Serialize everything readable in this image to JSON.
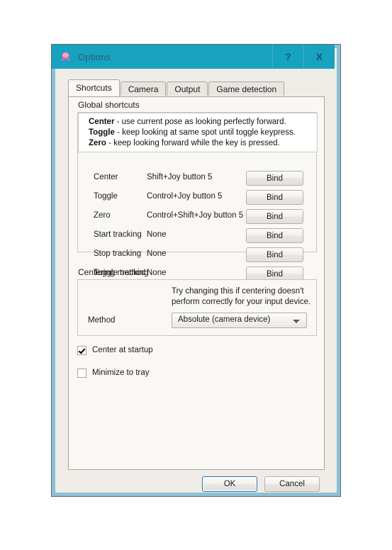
{
  "window": {
    "title": "Options",
    "icon": "opentrack-octopus-icon",
    "help_button": "?",
    "close_button": "X",
    "titlebar_color": "#17a2c0",
    "frame_color": "#8cc0d4",
    "dialog_background": "#efece8"
  },
  "tabs": [
    {
      "label": "Shortcuts",
      "active": true
    },
    {
      "label": "Camera",
      "active": false
    },
    {
      "label": "Output",
      "active": false
    },
    {
      "label": "Game detection",
      "active": false
    }
  ],
  "shortcuts_group": {
    "title": "Global shortcuts",
    "description": [
      {
        "term": "Center",
        "text": " - use current pose as looking perfectly forward."
      },
      {
        "term": "Toggle",
        "text": " - keep looking at same spot until toggle keypress."
      },
      {
        "term": "Zero",
        "text": " - keep looking forward while the key is pressed."
      }
    ],
    "rows": [
      {
        "label": "Center",
        "value": "Shift+Joy button 5",
        "button": "Bind"
      },
      {
        "label": "Toggle",
        "value": "Control+Joy button 5",
        "button": "Bind"
      },
      {
        "label": "Zero",
        "value": "Control+Shift+Joy button 5",
        "button": "Bind"
      },
      {
        "label": "Start tracking",
        "value": "None",
        "button": "Bind"
      },
      {
        "label": "Stop tracking",
        "value": "None",
        "button": "Bind"
      },
      {
        "label": "Toggle tracking",
        "value": "None",
        "button": "Bind"
      }
    ]
  },
  "centering_group": {
    "title": "Centering method",
    "hint_line_1": "Try changing this if centering doesn't",
    "hint_line_2": "perform correctly for your input device.",
    "method_label": "Method",
    "method_value": "Absolute (camera device)"
  },
  "checkboxes": [
    {
      "label": "Center at startup",
      "checked": true
    },
    {
      "label": "Minimize to tray",
      "checked": false
    }
  ],
  "footer": {
    "ok_label": "OK",
    "cancel_label": "Cancel"
  }
}
